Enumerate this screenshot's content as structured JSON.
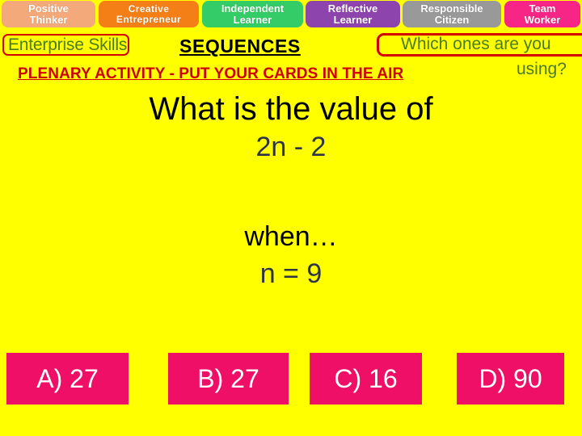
{
  "banner": {
    "skills": [
      {
        "line1": "Positive",
        "line2": "Thinker",
        "color": "#F4A97A"
      },
      {
        "line1": "Creative",
        "line2": "Entrepreneur",
        "color": "#F57F17"
      },
      {
        "line1": "Independent",
        "line2": "Learner",
        "color": "#33CC66"
      },
      {
        "line1": "Reflective",
        "line2": "Learner",
        "color": "#8E44AD"
      },
      {
        "line1": "Responsible",
        "line2": "Citizen",
        "color": "#999999"
      },
      {
        "line1": "Team",
        "line2": "Worker",
        "color": "#F72585"
      }
    ]
  },
  "subheader": {
    "enterprise_skills": "Enterprise Skills",
    "topic_title": "SEQUENCES",
    "prompt_line1": "Which ones are you",
    "prompt_line2": "using?",
    "plenary": "PLENARY ACTIVITY - PUT YOUR CARDS IN THE AIR"
  },
  "question": {
    "line1": "What is the value of",
    "expression": "2n - 2",
    "when_label": "when…",
    "variable_value": "n = 9"
  },
  "answers": [
    {
      "label": "A) 27"
    },
    {
      "label": "B) 27"
    },
    {
      "label": "C) 16"
    },
    {
      "label": "D) 90"
    }
  ],
  "colors": {
    "background": "#FFFF00",
    "answer_box": "#EF0F66",
    "accent_red": "#D40000",
    "plenary_red": "#CC0000",
    "green_text": "#4C7A1E",
    "navy_text": "#2E3447"
  }
}
